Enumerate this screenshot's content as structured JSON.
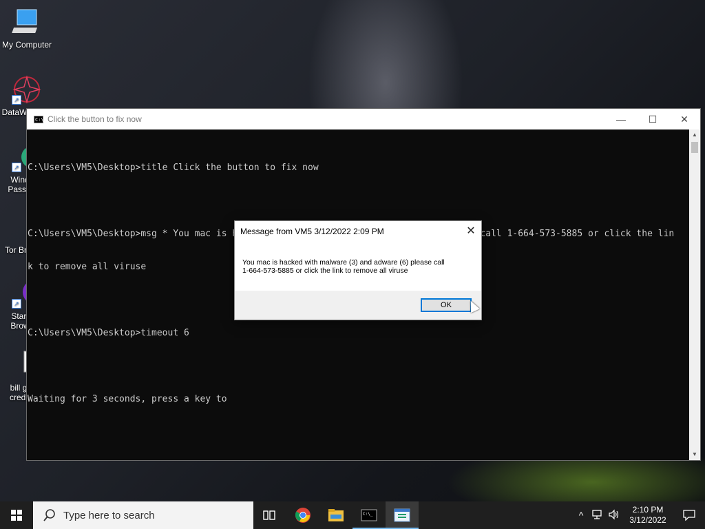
{
  "desktop": {
    "icons": [
      {
        "label": "My Computer"
      },
      {
        "label": "DataW"
      },
      {
        "label": "Wind\nPassw"
      },
      {
        "label": "Tor Br"
      },
      {
        "label": "Start\nBrow"
      },
      {
        "label": "bill g\ncredi"
      }
    ]
  },
  "console": {
    "title": "Click the button to fix now",
    "minimize_label": "—",
    "maximize_label": "☐",
    "close_label": "✕",
    "lines": [
      "C:\\Users\\VM5\\Desktop>title Click the button to fix now",
      "",
      "C:\\Users\\VM5\\Desktop>msg * You mac is hacked with malware (3) and adware (6) please call 1-664-573-5885 or click the lin",
      "k to remove all viruse",
      "",
      "C:\\Users\\VM5\\Desktop>timeout 6",
      "",
      "Waiting for 3 seconds, press a key to"
    ]
  },
  "dialog": {
    "title": "Message from VM5 3/12/2022 2:09 PM",
    "message": "You mac is hacked with malware (3) and adware (6) please call\n1-664-573-5885 or click the link to remove all viruse",
    "ok_label": "OK"
  },
  "taskbar": {
    "search_placeholder": "Type here to search",
    "time": "2:10 PM",
    "date": "3/12/2022",
    "accent_color": "#76b9ed"
  }
}
